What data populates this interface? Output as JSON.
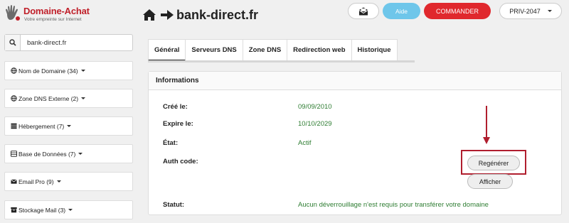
{
  "brand": {
    "name": "Domaine-Achat",
    "tagline": "Votre empreinte sur Internet",
    "color": "#c0202a"
  },
  "sidebar": {
    "search": {
      "value": "bank-direct.fr",
      "icon": "search-icon"
    },
    "items": [
      {
        "label": "Nom de Domaine (34)",
        "icon": "globe-icon"
      },
      {
        "label": "Zone DNS Externe (2)",
        "icon": "globe-icon"
      },
      {
        "label": "Hébergement (7)",
        "icon": "server-icon"
      },
      {
        "label": "Base de Données (7)",
        "icon": "database-icon"
      },
      {
        "label": "Email Pro (9)",
        "icon": "envelope-icon"
      },
      {
        "label": "Stockage Mail (3)",
        "icon": "archive-icon"
      }
    ]
  },
  "header": {
    "title": "bank-direct.fr",
    "help_label": "Aide",
    "order_label": "COMMANDER",
    "account_label": "PRIV-2047",
    "colors": {
      "help": "#6ec6ea",
      "order": "#e0282d"
    }
  },
  "tabs": [
    {
      "label": "Général",
      "active": true
    },
    {
      "label": "Serveurs DNS",
      "active": false
    },
    {
      "label": "Zone DNS",
      "active": false
    },
    {
      "label": "Redirection web",
      "active": false
    },
    {
      "label": "Historique",
      "active": false
    }
  ],
  "panel": {
    "title": "Informations",
    "rows": [
      {
        "label": "Créé le:",
        "value": "09/09/2010"
      },
      {
        "label": "Expire le:",
        "value": "10/10/2029"
      },
      {
        "label": "État:",
        "value": "Actif"
      },
      {
        "label": "Auth code:",
        "value": ""
      },
      {
        "label": "Statut:",
        "value": "Aucun déverrouillage n'est requis pour transférer votre domaine"
      }
    ],
    "regenerate_label": "Regénérer",
    "show_label": "Afficher",
    "value_color": "#2e7d32",
    "annotation_color": "#b01e2e"
  }
}
